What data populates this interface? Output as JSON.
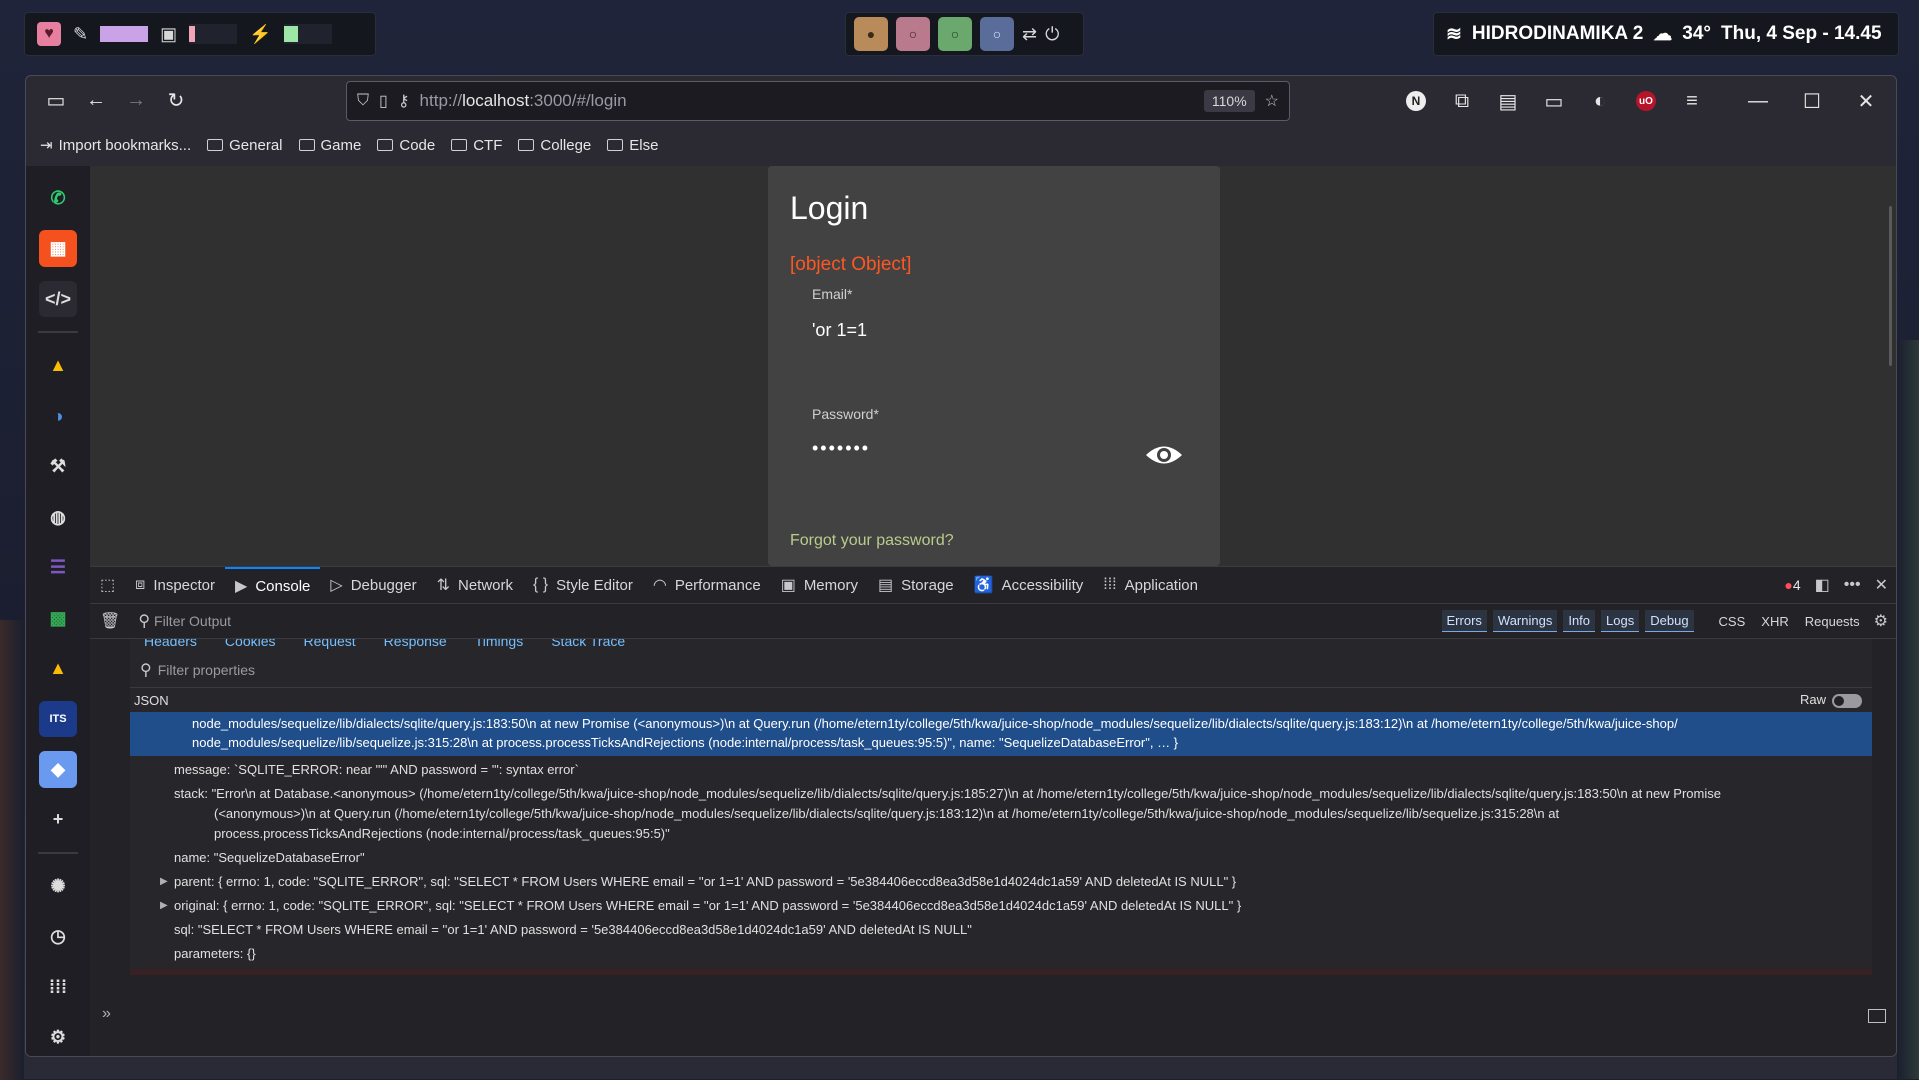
{
  "system": {
    "network_name": "HIDRODINAMIKA 2",
    "temperature": "34°",
    "datetime": "Thu, 4 Sep - 14.45"
  },
  "browser": {
    "url_prefix": "http://",
    "url_host": "localhost",
    "url_rest": ":3000/#/login",
    "zoom": "110%",
    "bookmarks": [
      "Import bookmarks...",
      "General",
      "Game",
      "Code",
      "CTF",
      "College",
      "Else"
    ]
  },
  "login": {
    "title": "Login",
    "error": "[object Object]",
    "email_label": "Email*",
    "email_value": "'or 1=1",
    "password_label": "Password*",
    "password_value": "•••••••",
    "forgot": "Forgot your password?"
  },
  "devtools": {
    "tabs": [
      "Inspector",
      "Console",
      "Debugger",
      "Network",
      "Style Editor",
      "Performance",
      "Memory",
      "Storage",
      "Accessibility",
      "Application"
    ],
    "error_count": "4",
    "filter_placeholder": "Filter Output",
    "filters": [
      "Errors",
      "Warnings",
      "Info",
      "Logs",
      "Debug"
    ],
    "filters_plain": [
      "CSS",
      "XHR",
      "Requests"
    ],
    "subtabs": [
      "Headers",
      "Cookies",
      "Request",
      "Response",
      "Timings",
      "Stack Trace"
    ],
    "filter_properties": "Filter properties",
    "json_label": "JSON",
    "raw_label": "Raw",
    "selected_line1": "node_modules/sequelize/lib/dialects/sqlite/query.js:183:50\\n at new Promise (<anonymous>)\\n at Query.run (/home/etern1ty/college/5th/kwa/juice-shop/node_modules/sequelize/lib/dialects/sqlite/query.js:183:12)\\n at /home/etern1ty/college/5th/kwa/juice-shop/",
    "selected_line2": "node_modules/sequelize/lib/sequelize.js:315:28\\n at process.processTicksAndRejections (node:internal/process/task_queues:95:5)\", name: \"SequelizeDatabaseError\", … }",
    "message": "message: `SQLITE_ERROR: near \"'\" AND password = '\": syntax error`",
    "stack_1": "stack: \"Error\\n at Database.<anonymous> (/home/etern1ty/college/5th/kwa/juice-shop/node_modules/sequelize/lib/dialects/sqlite/query.js:185:27)\\n at /home/etern1ty/college/5th/kwa/juice-shop/node_modules/sequelize/lib/dialects/sqlite/query.js:183:50\\n at new Promise",
    "stack_2": "(<anonymous>)\\n at Query.run (/home/etern1ty/college/5th/kwa/juice-shop/node_modules/sequelize/lib/dialects/sqlite/query.js:183:12)\\n at /home/etern1ty/college/5th/kwa/juice-shop/node_modules/sequelize/lib/sequelize.js:315:28\\n at",
    "stack_3": "process.processTicksAndRejections (node:internal/process/task_queues:95:5)\"",
    "name": "name: \"SequelizeDatabaseError\"",
    "parent": "parent: { errno: 1, code: \"SQLITE_ERROR\", sql: \"SELECT * FROM Users WHERE email = ''or 1=1' AND password = '5e384406eccd8ea3d58e1d4024dc1a59' AND deletedAt IS NULL\" }",
    "original": "original: { errno: 1, code: \"SQLITE_ERROR\", sql: \"SELECT * FROM Users WHERE email = ''or 1=1' AND password = '5e384406eccd8ea3d58e1d4024dc1a59' AND deletedAt IS NULL\" }",
    "sql": "sql: \"SELECT * FROM Users WHERE email = ''or 1=1' AND password = '5e384406eccd8ea3d58e1d4024dc1a59' AND deletedAt IS NULL\"",
    "parameters": "parameters: {}"
  },
  "icons": [
    "heart-icon",
    "pencil-icon",
    "cpu-icon",
    "bolt-icon",
    "wifi-icon",
    "weather-icon",
    "sidebar-toggle-icon",
    "back-icon",
    "forward-icon",
    "reload-icon",
    "shield-icon",
    "page-icon",
    "key-icon",
    "star-icon",
    "eye-icon",
    "gear-icon",
    "trash-icon",
    "filter-icon"
  ],
  "colors": {
    "error": "#ff5722",
    "link": "#b9cc8c",
    "selection": "#204e8a",
    "accent": "#0a84ff"
  }
}
